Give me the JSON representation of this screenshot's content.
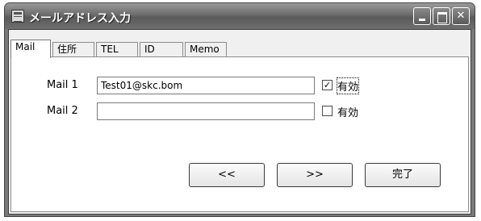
{
  "window": {
    "title": "メールアドレス入力",
    "caption_buttons": {
      "minimize": "",
      "maximize": "",
      "close": "✕"
    }
  },
  "tabs": [
    {
      "label": "Mail",
      "active": true
    },
    {
      "label": "住所",
      "active": false
    },
    {
      "label": "TEL",
      "active": false
    },
    {
      "label": "ID",
      "active": false
    },
    {
      "label": "Memo",
      "active": false
    }
  ],
  "mail1": {
    "label": "Mail 1",
    "value": "Test01@skc.bom",
    "valid_label": "有効",
    "valid_checked": true,
    "check_mark": "✓"
  },
  "mail2": {
    "label": "Mail 2",
    "value": "",
    "valid_label": "有効",
    "valid_checked": false,
    "check_mark": ""
  },
  "buttons": {
    "prev": "<<",
    "next": ">>",
    "done": "完了"
  }
}
